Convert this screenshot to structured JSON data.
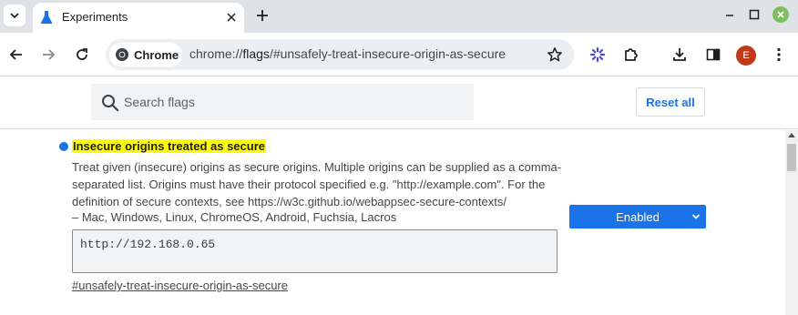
{
  "tabstrip": {
    "tab_title": "Experiments"
  },
  "toolbar": {
    "chip_label": "Chrome",
    "url_scheme": "chrome://",
    "url_host": "flags",
    "url_rest": "/#unsafely-treat-insecure-origin-as-secure",
    "avatar_initial": "E"
  },
  "flags_header": {
    "search_placeholder": "Search flags",
    "reset_label": "Reset all"
  },
  "flag": {
    "title": "Insecure origins treated as secure",
    "description": "Treat given (insecure) origins as secure origins. Multiple origins can be supplied as a comma-separated list. Origins must have their protocol specified e.g. \"http://example.com\". For the definition of secure contexts, see https://w3c.github.io/webappsec-secure-contexts/",
    "platforms": "– Mac, Windows, Linux, ChromeOS, Android, Fuchsia, Lacros",
    "origins_value": "http://192.168.0.65",
    "link": "#unsafely-treat-insecure-origin-as-secure",
    "state": "Enabled"
  },
  "colors": {
    "accent": "#1a73e8",
    "highlight": "#ffff00",
    "tabstrip_bg": "#dfe3e7"
  }
}
